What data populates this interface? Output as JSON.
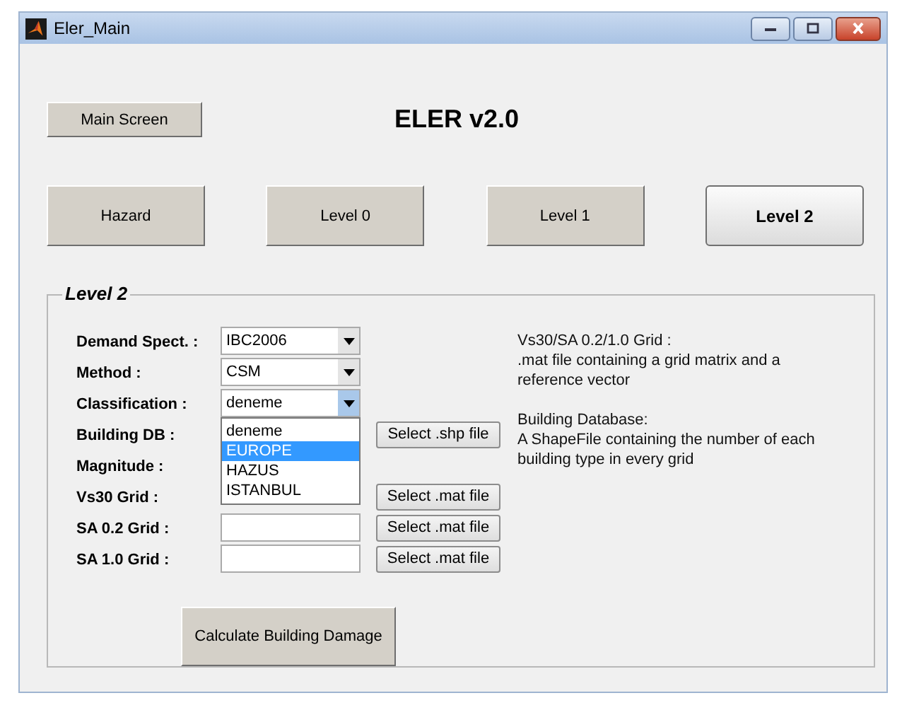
{
  "window": {
    "title": "Eler_Main"
  },
  "main_button": "Main Screen",
  "app_title": "ELER v2.0",
  "tabs": [
    {
      "label": "Hazard",
      "selected": false
    },
    {
      "label": "Level 0",
      "selected": false
    },
    {
      "label": "Level 1",
      "selected": false
    },
    {
      "label": "Level 2",
      "selected": true
    }
  ],
  "panel": {
    "title": "Level 2",
    "rows": [
      {
        "label": "Demand Spect. :",
        "kind": "popup",
        "value": "IBC2006",
        "expanded": false
      },
      {
        "label": "Method :",
        "kind": "popup",
        "value": "CSM",
        "expanded": false
      },
      {
        "label": "Classification :",
        "kind": "popup",
        "value": "deneme",
        "expanded": true,
        "options": [
          {
            "label": "deneme",
            "highlighted": false
          },
          {
            "label": "EUROPE",
            "highlighted": true
          },
          {
            "label": "HAZUS",
            "highlighted": false
          },
          {
            "label": "ISTANBUL",
            "highlighted": false
          }
        ]
      },
      {
        "label": "Building DB :",
        "kind": "covered",
        "button": "Select .shp file"
      },
      {
        "label": "Magnitude :",
        "kind": "covered"
      },
      {
        "label": "Vs30 Grid :",
        "kind": "covered",
        "button": "Select .mat file"
      },
      {
        "label": "SA 0.2 Grid :",
        "kind": "field",
        "button": "Select .mat file"
      },
      {
        "label": "SA 1.0 Grid :",
        "kind": "field",
        "button": "Select .mat file"
      }
    ],
    "help": [
      {
        "heading": "Vs30/SA 0.2/1.0 Grid :",
        "text": ".mat file containing a grid matrix and a reference vector"
      },
      {
        "heading": "Building Database:",
        "text": "A ShapeFile containing the number of each building type in every grid"
      }
    ],
    "calculate_button": "Calculate Building Damage"
  }
}
